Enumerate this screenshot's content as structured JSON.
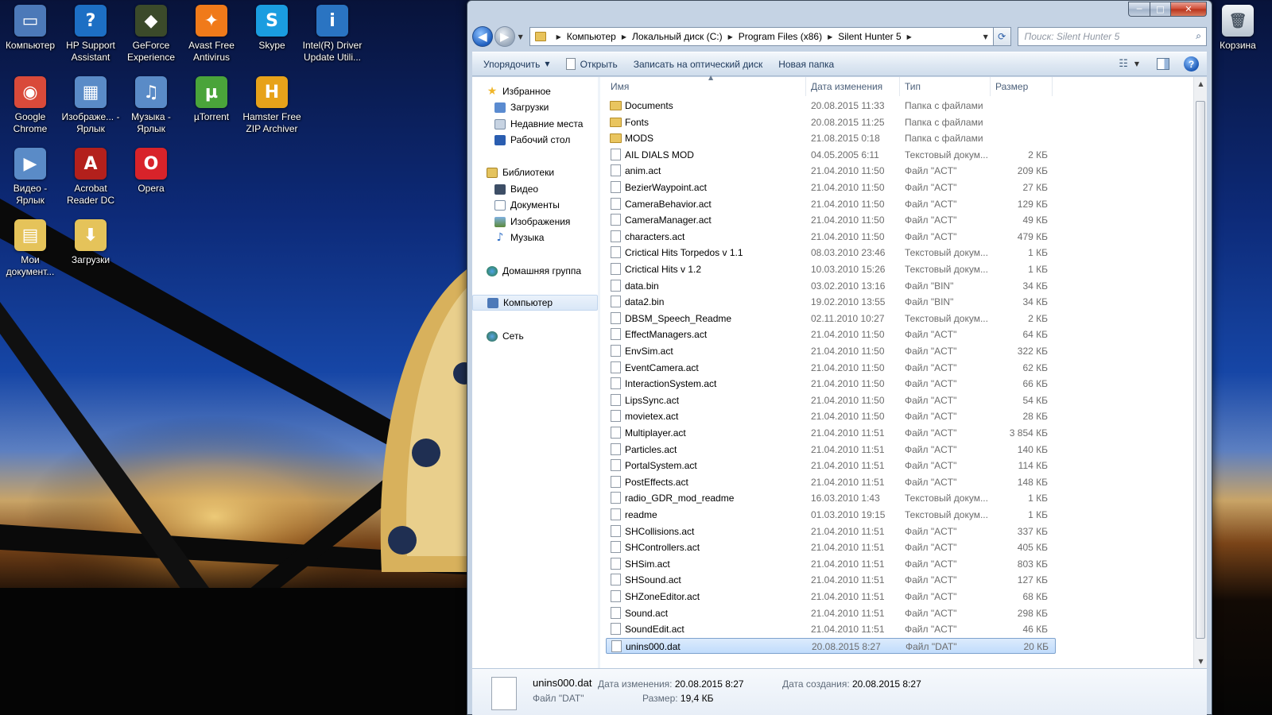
{
  "desktop": {
    "icons": [
      {
        "label": "Компьютер",
        "icon": "computer-icon",
        "color": "#4c79b8"
      },
      {
        "label": "HP Support Assistant",
        "icon": "help-question-icon",
        "color": "#1d6fc4"
      },
      {
        "label": "GeForce Experience",
        "icon": "nvidia-icon",
        "color": "#3b4a2a"
      },
      {
        "label": "Avast Free Antivirus",
        "icon": "avast-icon",
        "color": "#f07a1a"
      },
      {
        "label": "Skype",
        "icon": "skype-icon",
        "color": "#1a9de0"
      },
      {
        "label": "Intel(R) Driver Update Utili...",
        "icon": "intel-icon",
        "color": "#2a74c2"
      },
      {
        "label": "Google Chrome",
        "icon": "chrome-icon",
        "color": "#d94a3a"
      },
      {
        "label": "Изображе... - Ярлык",
        "icon": "pictures-shortcut-icon",
        "color": "#5a8bc7"
      },
      {
        "label": "Музыка - Ярлык",
        "icon": "music-shortcut-icon",
        "color": "#5a8bc7"
      },
      {
        "label": "µTorrent",
        "icon": "utorrent-icon",
        "color": "#4aa43a"
      },
      {
        "label": "Hamster Free ZIP Archiver",
        "icon": "hamster-zip-icon",
        "color": "#e7a21a"
      },
      {
        "label": "Видео - Ярлык",
        "icon": "video-shortcut-icon",
        "color": "#5a8bc7"
      },
      {
        "label": "Acrobat Reader DC",
        "icon": "acrobat-icon",
        "color": "#b3201c"
      },
      {
        "label": "Opera",
        "icon": "opera-icon",
        "color": "#d8232a"
      },
      {
        "label": "Мои документ...",
        "icon": "documents-folder-icon",
        "color": "#e5c35a"
      },
      {
        "label": "Загрузки",
        "icon": "downloads-folder-icon",
        "color": "#e5c35a"
      }
    ],
    "recycle_bin": {
      "label": "Корзина",
      "icon": "recycle-bin-icon"
    }
  },
  "window": {
    "caption": {
      "minimize": "─",
      "maximize": "□",
      "close": "✕"
    },
    "breadcrumb": [
      "Компьютер",
      "Локальный диск (C:)",
      "Program Files (x86)",
      "Silent Hunter 5"
    ],
    "search_placeholder": "Поиск: Silent Hunter 5",
    "toolbar": {
      "organize": "Упорядочить",
      "open": "Открыть",
      "burn": "Записать на оптический диск",
      "new_folder": "Новая папка"
    },
    "nav_pane": {
      "favorites": "Избранное",
      "favorites_items": [
        "Загрузки",
        "Недавние места",
        "Рабочий стол"
      ],
      "libraries": "Библиотеки",
      "libraries_items": [
        "Видео",
        "Документы",
        "Изображения",
        "Музыка"
      ],
      "homegroup": "Домашняя группа",
      "computer": "Компьютер",
      "network": "Сеть"
    },
    "columns": {
      "name": "Имя",
      "date": "Дата изменения",
      "type": "Тип",
      "size": "Размер"
    },
    "files": [
      {
        "name": "Documents",
        "date": "20.08.2015 11:33",
        "type": "Папка с файлами",
        "size": "",
        "kind": "folder"
      },
      {
        "name": "Fonts",
        "date": "20.08.2015 11:25",
        "type": "Папка с файлами",
        "size": "",
        "kind": "folder"
      },
      {
        "name": "MODS",
        "date": "21.08.2015 0:18",
        "type": "Папка с файлами",
        "size": "",
        "kind": "folder"
      },
      {
        "name": "AIL DIALS MOD",
        "date": "04.05.2005 6:11",
        "type": "Текстовый докум...",
        "size": "2 КБ",
        "kind": "file"
      },
      {
        "name": "anim.act",
        "date": "21.04.2010 11:50",
        "type": "Файл \"ACT\"",
        "size": "209 КБ",
        "kind": "file"
      },
      {
        "name": "BezierWaypoint.act",
        "date": "21.04.2010 11:50",
        "type": "Файл \"ACT\"",
        "size": "27 КБ",
        "kind": "file"
      },
      {
        "name": "CameraBehavior.act",
        "date": "21.04.2010 11:50",
        "type": "Файл \"ACT\"",
        "size": "129 КБ",
        "kind": "file"
      },
      {
        "name": "CameraManager.act",
        "date": "21.04.2010 11:50",
        "type": "Файл \"ACT\"",
        "size": "49 КБ",
        "kind": "file"
      },
      {
        "name": "characters.act",
        "date": "21.04.2010 11:50",
        "type": "Файл \"ACT\"",
        "size": "479 КБ",
        "kind": "file"
      },
      {
        "name": "Crictical Hits Torpedos v 1.1",
        "date": "08.03.2010 23:46",
        "type": "Текстовый докум...",
        "size": "1 КБ",
        "kind": "file"
      },
      {
        "name": "Crictical Hits v 1.2",
        "date": "10.03.2010 15:26",
        "type": "Текстовый докум...",
        "size": "1 КБ",
        "kind": "file"
      },
      {
        "name": "data.bin",
        "date": "03.02.2010 13:16",
        "type": "Файл \"BIN\"",
        "size": "34 КБ",
        "kind": "file"
      },
      {
        "name": "data2.bin",
        "date": "19.02.2010 13:55",
        "type": "Файл \"BIN\"",
        "size": "34 КБ",
        "kind": "file"
      },
      {
        "name": "DBSM_Speech_Readme",
        "date": "02.11.2010 10:27",
        "type": "Текстовый докум...",
        "size": "2 КБ",
        "kind": "file"
      },
      {
        "name": "EffectManagers.act",
        "date": "21.04.2010 11:50",
        "type": "Файл \"ACT\"",
        "size": "64 КБ",
        "kind": "file"
      },
      {
        "name": "EnvSim.act",
        "date": "21.04.2010 11:50",
        "type": "Файл \"ACT\"",
        "size": "322 КБ",
        "kind": "file"
      },
      {
        "name": "EventCamera.act",
        "date": "21.04.2010 11:50",
        "type": "Файл \"ACT\"",
        "size": "62 КБ",
        "kind": "file"
      },
      {
        "name": "InteractionSystem.act",
        "date": "21.04.2010 11:50",
        "type": "Файл \"ACT\"",
        "size": "66 КБ",
        "kind": "file"
      },
      {
        "name": "LipsSync.act",
        "date": "21.04.2010 11:50",
        "type": "Файл \"ACT\"",
        "size": "54 КБ",
        "kind": "file"
      },
      {
        "name": "movietex.act",
        "date": "21.04.2010 11:50",
        "type": "Файл \"ACT\"",
        "size": "28 КБ",
        "kind": "file"
      },
      {
        "name": "Multiplayer.act",
        "date": "21.04.2010 11:51",
        "type": "Файл \"ACT\"",
        "size": "3 854 КБ",
        "kind": "file"
      },
      {
        "name": "Particles.act",
        "date": "21.04.2010 11:51",
        "type": "Файл \"ACT\"",
        "size": "140 КБ",
        "kind": "file"
      },
      {
        "name": "PortalSystem.act",
        "date": "21.04.2010 11:51",
        "type": "Файл \"ACT\"",
        "size": "114 КБ",
        "kind": "file"
      },
      {
        "name": "PostEffects.act",
        "date": "21.04.2010 11:51",
        "type": "Файл \"ACT\"",
        "size": "148 КБ",
        "kind": "file"
      },
      {
        "name": "radio_GDR_mod_readme",
        "date": "16.03.2010 1:43",
        "type": "Текстовый докум...",
        "size": "1 КБ",
        "kind": "file"
      },
      {
        "name": "readme",
        "date": "01.03.2010 19:15",
        "type": "Текстовый докум...",
        "size": "1 КБ",
        "kind": "file"
      },
      {
        "name": "SHCollisions.act",
        "date": "21.04.2010 11:51",
        "type": "Файл \"ACT\"",
        "size": "337 КБ",
        "kind": "file"
      },
      {
        "name": "SHControllers.act",
        "date": "21.04.2010 11:51",
        "type": "Файл \"ACT\"",
        "size": "405 КБ",
        "kind": "file"
      },
      {
        "name": "SHSim.act",
        "date": "21.04.2010 11:51",
        "type": "Файл \"ACT\"",
        "size": "803 КБ",
        "kind": "file"
      },
      {
        "name": "SHSound.act",
        "date": "21.04.2010 11:51",
        "type": "Файл \"ACT\"",
        "size": "127 КБ",
        "kind": "file"
      },
      {
        "name": "SHZoneEditor.act",
        "date": "21.04.2010 11:51",
        "type": "Файл \"ACT\"",
        "size": "68 КБ",
        "kind": "file"
      },
      {
        "name": "Sound.act",
        "date": "21.04.2010 11:51",
        "type": "Файл \"ACT\"",
        "size": "298 КБ",
        "kind": "file"
      },
      {
        "name": "SoundEdit.act",
        "date": "21.04.2010 11:51",
        "type": "Файл \"ACT\"",
        "size": "46 КБ",
        "kind": "file"
      },
      {
        "name": "unins000.dat",
        "date": "20.08.2015 8:27",
        "type": "Файл \"DAT\"",
        "size": "20 КБ",
        "kind": "file",
        "selected": true
      }
    ],
    "details": {
      "name": "unins000.dat",
      "type": "Файл \"DAT\"",
      "modified_label": "Дата изменения:",
      "modified": "20.08.2015 8:27",
      "created_label": "Дата создания:",
      "created": "20.08.2015 8:27",
      "size_label": "Размер:",
      "size": "19,4 КБ"
    }
  }
}
